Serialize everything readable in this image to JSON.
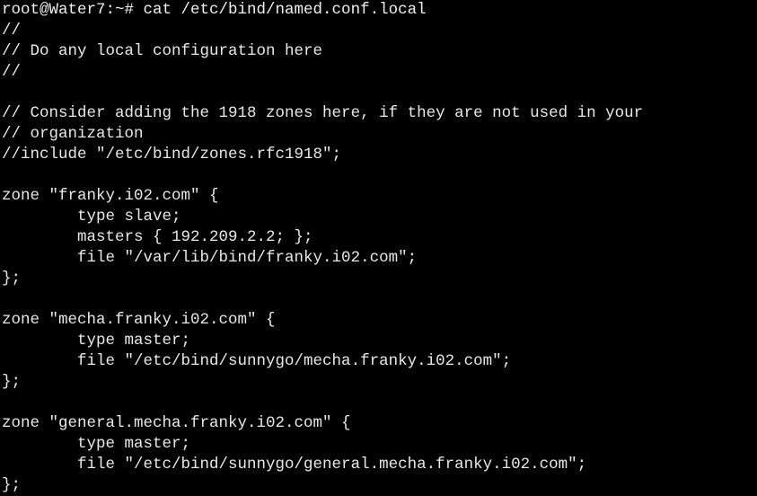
{
  "terminal": {
    "lines": [
      "root@Water7:~# cat /etc/bind/named.conf.local",
      "//",
      "// Do any local configuration here",
      "//",
      "",
      "// Consider adding the 1918 zones here, if they are not used in your",
      "// organization",
      "//include \"/etc/bind/zones.rfc1918\";",
      "",
      "zone \"franky.i02.com\" {",
      "        type slave;",
      "        masters { 192.209.2.2; };",
      "        file \"/var/lib/bind/franky.i02.com\";",
      "};",
      "",
      "zone \"mecha.franky.i02.com\" {",
      "        type master;",
      "        file \"/etc/bind/sunnygo/mecha.franky.i02.com\";",
      "};",
      "",
      "zone \"general.mecha.franky.i02.com\" {",
      "        type master;",
      "        file \"/etc/bind/sunnygo/general.mecha.franky.i02.com\";",
      "};"
    ]
  },
  "colors": {
    "background": "#000000",
    "text": "#e8e8e8"
  }
}
